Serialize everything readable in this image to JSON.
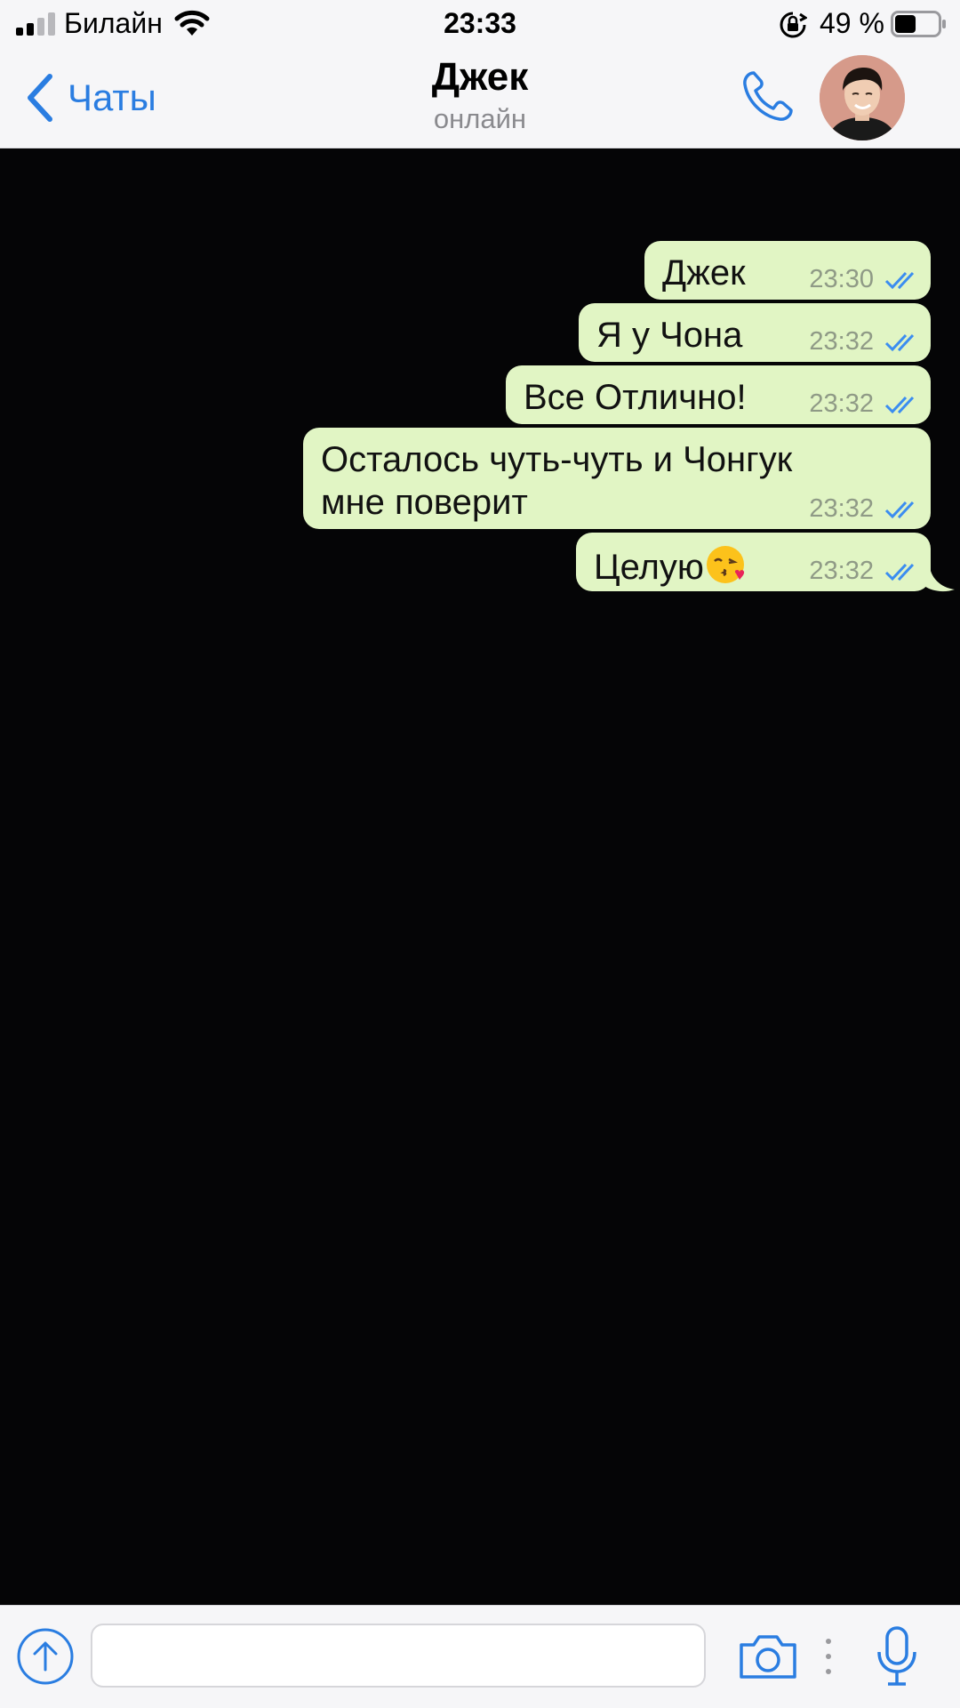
{
  "status_bar": {
    "carrier": "Билайн",
    "time": "23:33",
    "battery_percent": "49 %",
    "battery_level": 0.49,
    "signal_icon": "signal-bars-icon",
    "wifi_icon": "wifi-icon",
    "rotation_lock_icon": "rotation-lock-icon"
  },
  "header": {
    "back_label": "Чаты",
    "title": "Джек",
    "subtitle": "онлайн",
    "call_icon": "phone-icon",
    "avatar": "contact-avatar-photo"
  },
  "messages": [
    {
      "text": "Джек",
      "time": "23:30",
      "status": "read"
    },
    {
      "text": "Я у Чона",
      "time": "23:32",
      "status": "read"
    },
    {
      "text": "Все Отлично!",
      "time": "23:32",
      "status": "read"
    },
    {
      "text_line1": "Осталось чуть-чуть и Чонгук",
      "text_line2": "мне поверит",
      "time": "23:32",
      "status": "read"
    },
    {
      "text": "Целую",
      "emoji": "kissing-face-icon",
      "time": "23:32",
      "status": "read"
    }
  ],
  "input_bar": {
    "placeholder": "",
    "value": "",
    "attach_icon": "upload-arrow-icon",
    "camera_icon": "camera-icon",
    "mic_icon": "microphone-icon"
  },
  "colors": {
    "accent": "#2a7de1",
    "outgoing_bubble": "#e1f5c4",
    "chat_background": "#050506",
    "bar_background": "#f6f6f8",
    "read_ticks": "#3b8df0"
  }
}
